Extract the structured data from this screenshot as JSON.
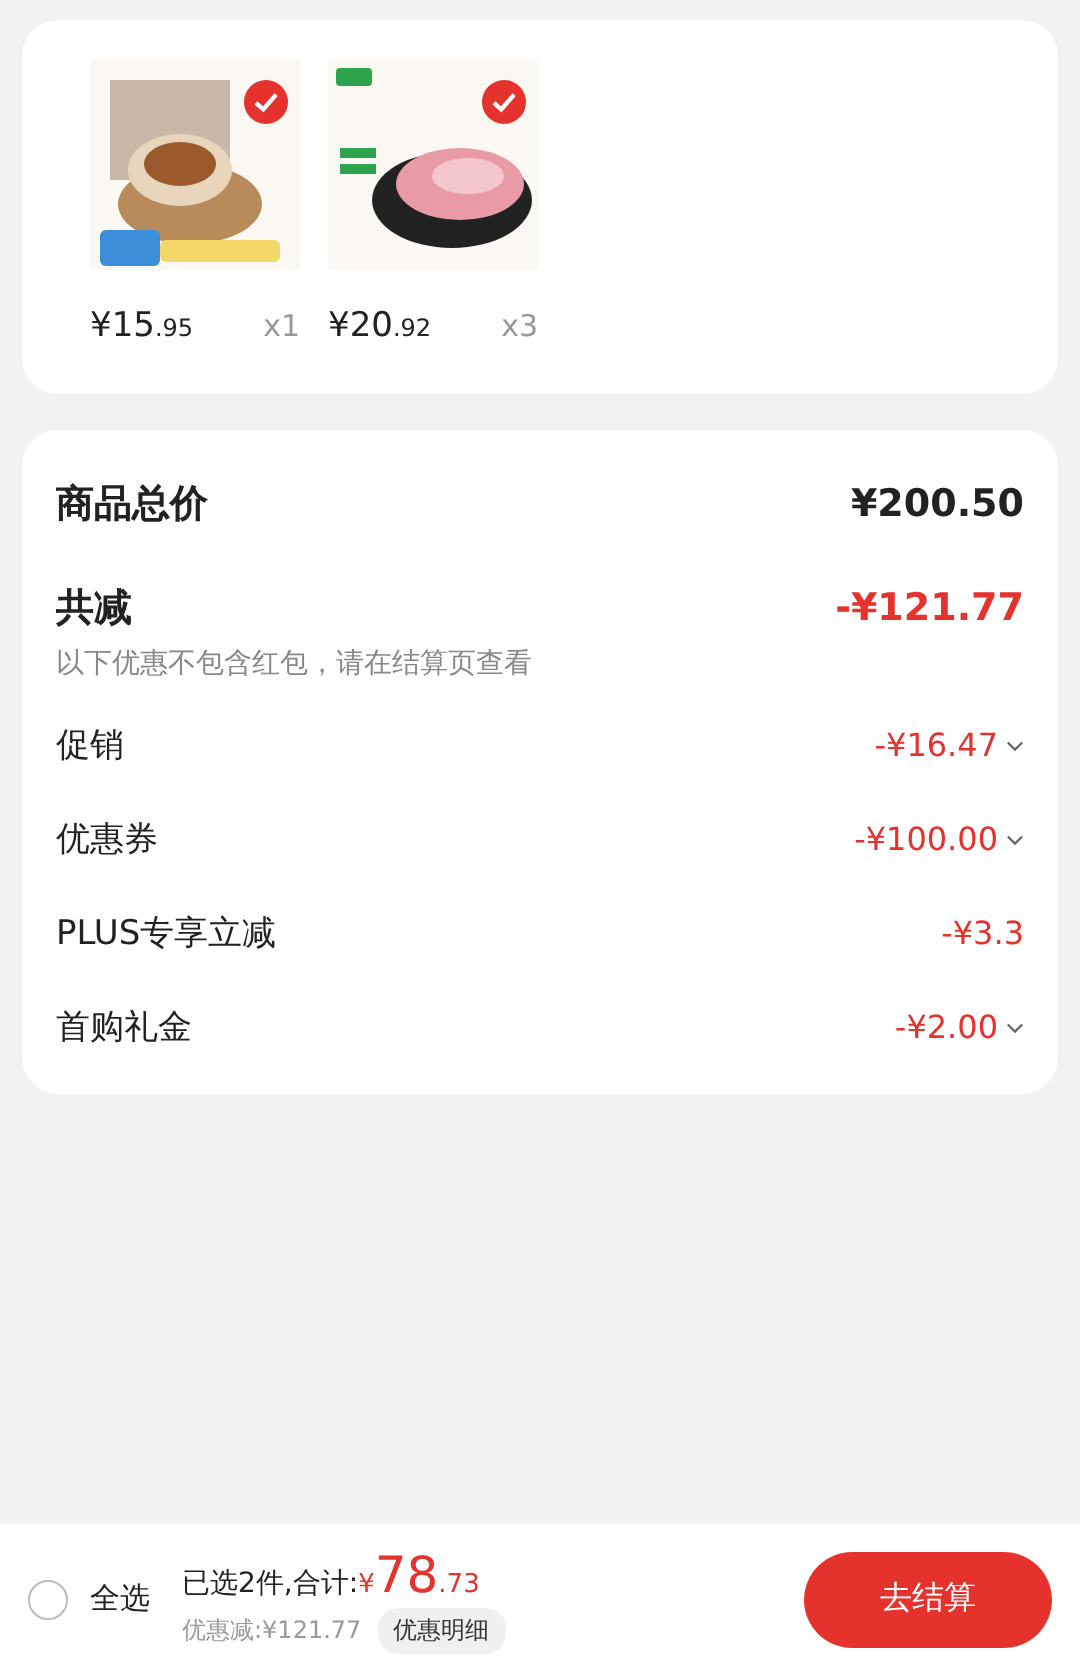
{
  "products": [
    {
      "kind": "picture",
      "selected": true,
      "price_int": "¥15",
      "price_dec": ".95",
      "qty": "x1"
    },
    {
      "kind": "picture",
      "selected": true,
      "price_int": "¥20",
      "price_dec": ".92",
      "qty": "x3"
    }
  ],
  "summary": {
    "total_label": "商品总价",
    "total_value": "¥200.50",
    "discount_label": "共减",
    "discount_value": "-¥121.77",
    "note": "以下优惠不包含红包，请在结算页查看"
  },
  "details": [
    {
      "label": "促销",
      "value": "-¥16.47",
      "expandable": true
    },
    {
      "label": "优惠券",
      "value": "-¥100.00",
      "expandable": true
    },
    {
      "label": "PLUS专享立减",
      "value": "-¥3.3",
      "expandable": false
    },
    {
      "label": "首购礼金",
      "value": "-¥2.00",
      "expandable": true
    }
  ],
  "bottom_bar": {
    "select_all": {
      "label": "全选",
      "checked": false
    },
    "summary": "已选2件,合计:",
    "currency": "¥",
    "total_int": "78",
    "total_dec": ".73",
    "saved": "优惠减:¥121.77",
    "detail_button": "优惠明细",
    "checkout_button": "去结算"
  }
}
